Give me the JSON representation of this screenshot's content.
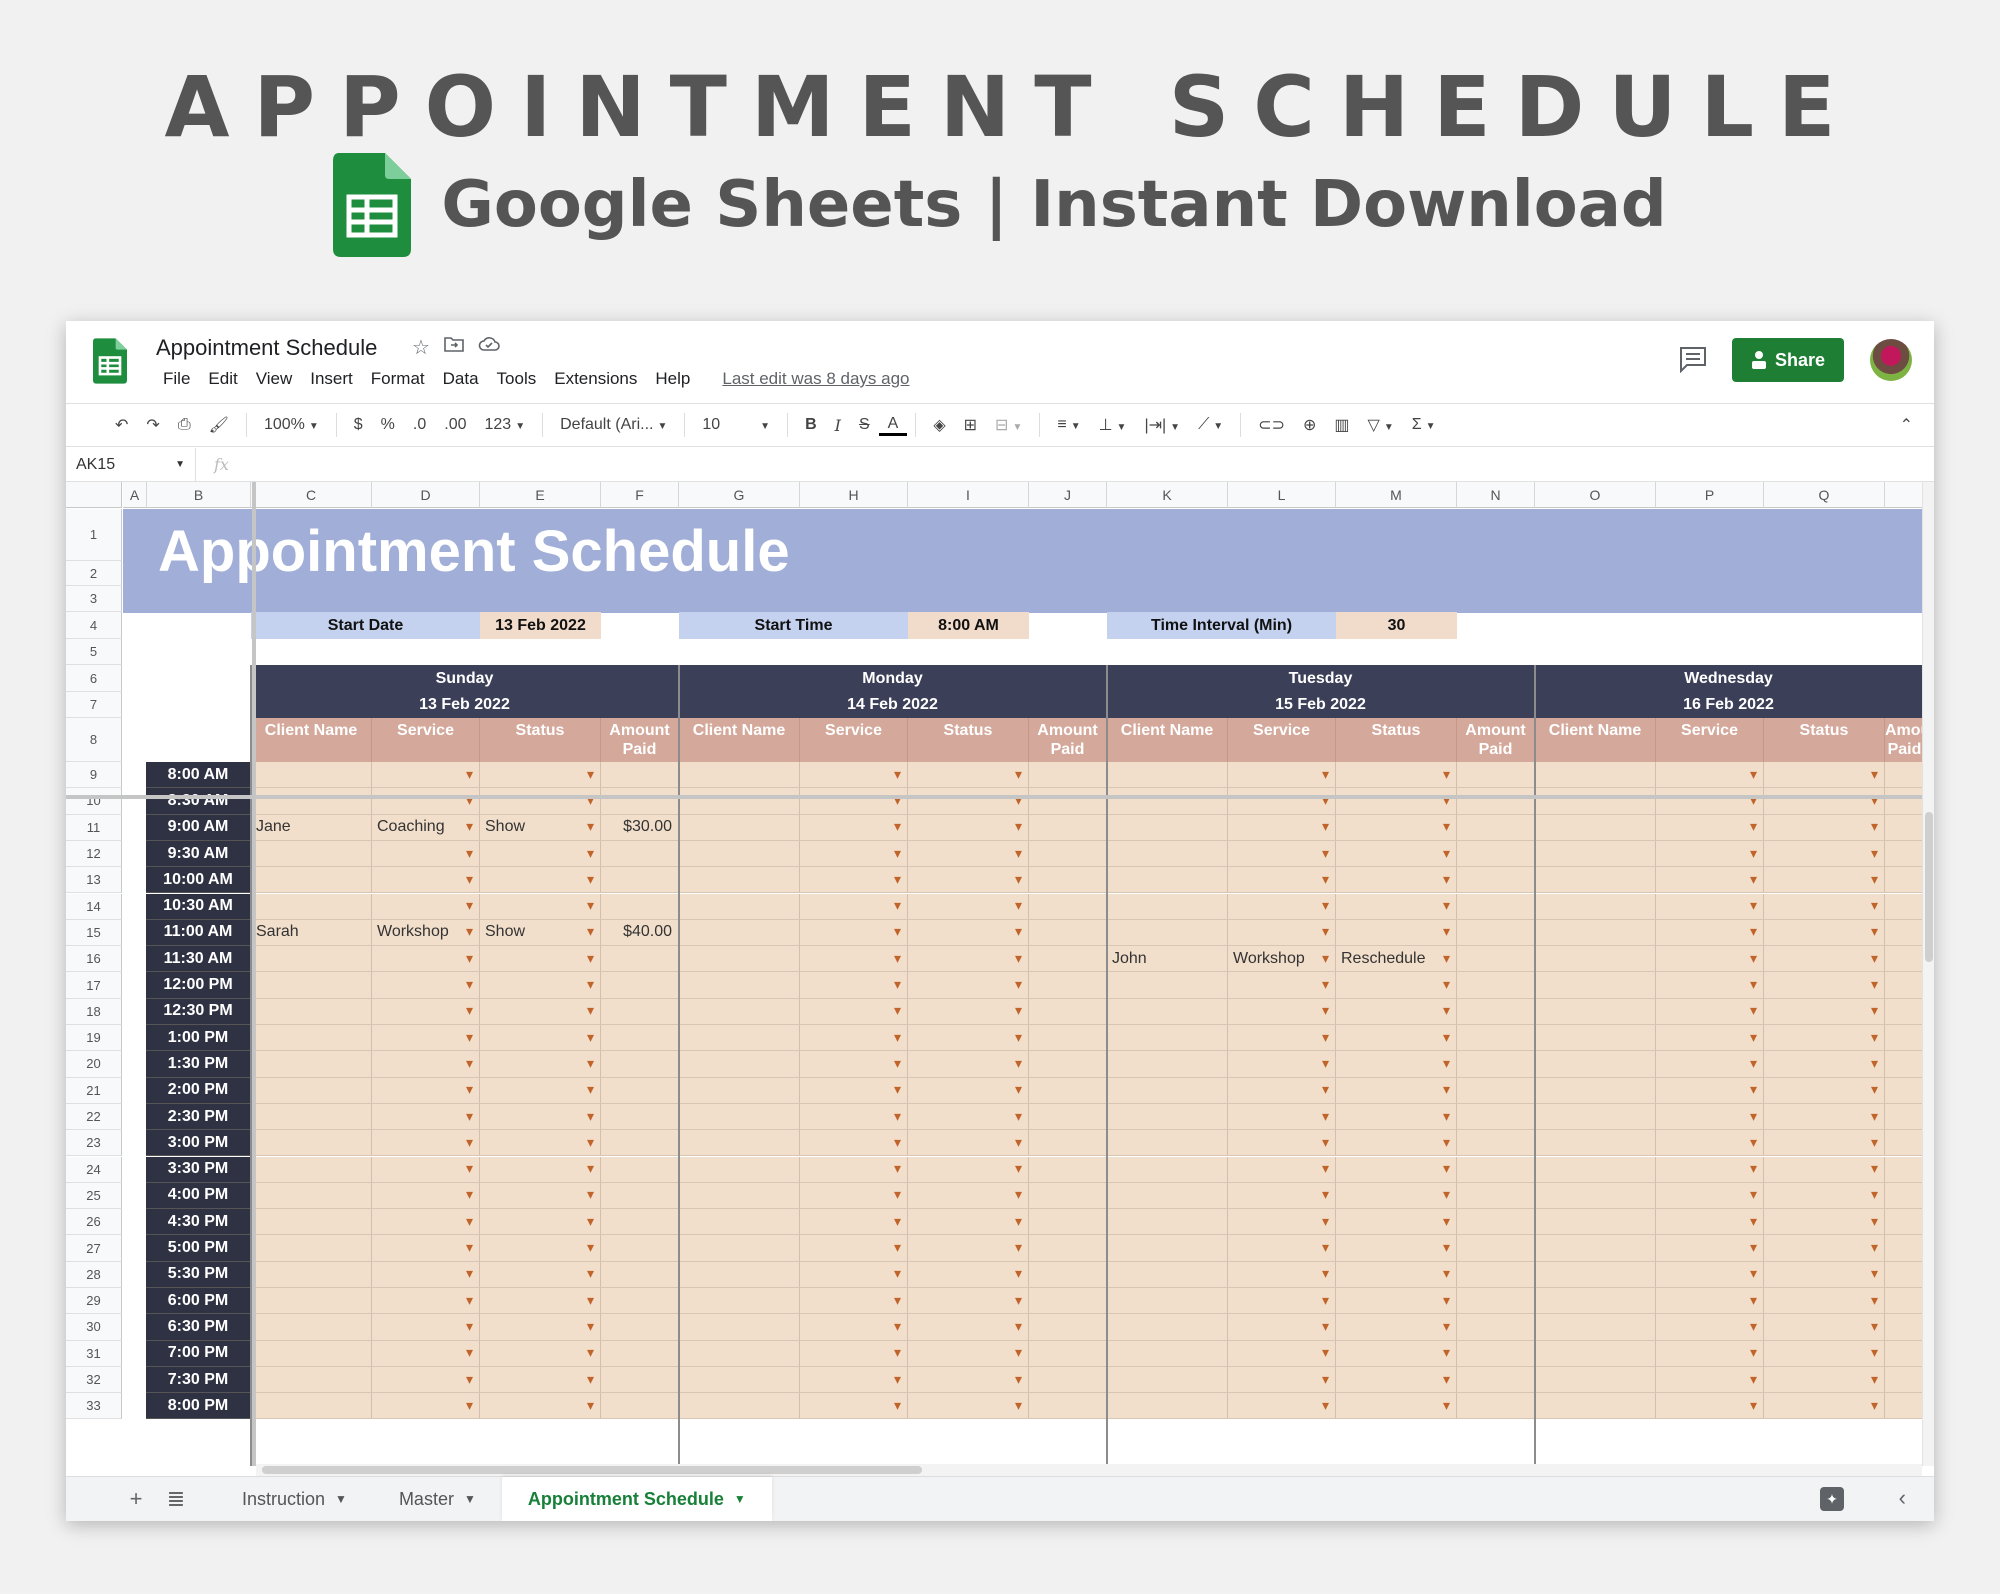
{
  "promo": {
    "title": "APPOINTMENT SCHEDULE",
    "subtitle": "Google Sheets | Instant Download",
    "logo_color": "#1e8e3e"
  },
  "app": {
    "doc_title": "Appointment Schedule",
    "title_icons": [
      "star-icon",
      "move-folder-icon",
      "cloud-status-icon"
    ],
    "menu": [
      "File",
      "Edit",
      "View",
      "Insert",
      "Format",
      "Data",
      "Tools",
      "Extensions",
      "Help"
    ],
    "last_edit": "Last edit was 8 days ago",
    "share_label": "Share",
    "accent": "#1e7e34"
  },
  "toolbar": {
    "zoom": "100%",
    "currency": "$",
    "percent": "%",
    "dec_less": ".0",
    "dec_more": ".00",
    "format_more": "123",
    "font": "Default (Ari...",
    "font_size": "10",
    "bold": "B",
    "italic": "I",
    "strike": "S",
    "text_color": "A",
    "sum": "Σ"
  },
  "formula_bar": {
    "name_box": "AK15",
    "fx": "fx"
  },
  "sheet": {
    "columns": [
      "A",
      "B",
      "C",
      "D",
      "E",
      "F",
      "G",
      "H",
      "I",
      "J",
      "K",
      "L",
      "M",
      "N",
      "O",
      "P",
      "Q"
    ],
    "rows": [
      "1",
      "2",
      "3",
      "4",
      "5",
      "6",
      "7",
      "8",
      "9",
      "10",
      "11",
      "12",
      "13",
      "14",
      "15",
      "16",
      "17",
      "18",
      "19",
      "20",
      "21",
      "22",
      "23",
      "24",
      "25",
      "26",
      "27",
      "28",
      "29",
      "30",
      "31",
      "32",
      "33"
    ],
    "banner_title": "Appointment Schedule",
    "params": {
      "start_date_label": "Start Date",
      "start_date": "13 Feb 2022",
      "start_time_label": "Start Time",
      "start_time": "8:00 AM",
      "interval_label": "Time Interval (Min)",
      "interval": "30"
    },
    "days": [
      {
        "name": "Sunday",
        "date": "13 Feb 2022"
      },
      {
        "name": "Monday",
        "date": "14 Feb 2022"
      },
      {
        "name": "Tuesday",
        "date": "15 Feb 2022"
      },
      {
        "name": "Wednesday",
        "date": "16 Feb 2022"
      }
    ],
    "day_columns": [
      "Client Name",
      "Service",
      "Status",
      "Amount Paid"
    ],
    "times": [
      "8:00 AM",
      "8:30 AM",
      "9:00 AM",
      "9:30 AM",
      "10:00 AM",
      "10:30 AM",
      "11:00 AM",
      "11:30 AM",
      "12:00 PM",
      "12:30 PM",
      "1:00 PM",
      "1:30 PM",
      "2:00 PM",
      "2:30 PM",
      "3:00 PM",
      "3:30 PM",
      "4:00 PM",
      "4:30 PM",
      "5:00 PM",
      "5:30 PM",
      "6:00 PM",
      "6:30 PM",
      "7:00 PM",
      "7:30 PM",
      "8:00 PM"
    ],
    "entries": [
      {
        "day": 0,
        "slot": 2,
        "client": "Jane",
        "service": "Coaching",
        "status": "Show",
        "amount": "$30.00"
      },
      {
        "day": 0,
        "slot": 6,
        "client": "Sarah",
        "service": "Workshop",
        "status": "Show",
        "amount": "$40.00"
      },
      {
        "day": 2,
        "slot": 7,
        "client": "John",
        "service": "Workshop",
        "status": "Reschedule",
        "amount": ""
      }
    ],
    "colors": {
      "banner": "#a0aed8",
      "day_header": "#3b3f57",
      "col_header": "#d4a89a",
      "cell": "#f2dfcb",
      "time_cell": "#2f3243",
      "param_label": "#c5d2ef",
      "param_value": "#f1dccb"
    }
  },
  "tabs": {
    "sheets": [
      "Instruction",
      "Master",
      "Appointment Schedule"
    ],
    "active": "Appointment Schedule"
  }
}
